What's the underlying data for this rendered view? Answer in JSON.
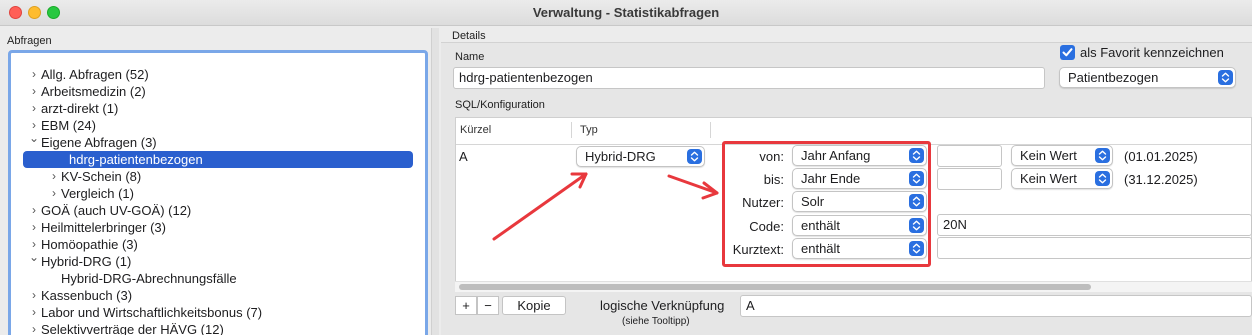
{
  "window": {
    "title": "Verwaltung - Statistikabfragen"
  },
  "left": {
    "header": "Abfragen",
    "tree": [
      {
        "label": "Allg. Abfragen (52)",
        "chevron": "right",
        "level": 0
      },
      {
        "label": "Arbeitsmedizin (2)",
        "chevron": "right",
        "level": 0
      },
      {
        "label": "arzt-direkt (1)",
        "chevron": "right",
        "level": 0
      },
      {
        "label": "EBM (24)",
        "chevron": "right",
        "level": 0
      },
      {
        "label": "Eigene Abfragen (3)",
        "chevron": "down",
        "level": 0
      },
      {
        "label": "hdrg-patientenbezogen",
        "chevron": "none",
        "level": 1,
        "selected": true
      },
      {
        "label": "KV-Schein (8)",
        "chevron": "right",
        "level": 1
      },
      {
        "label": "Vergleich (1)",
        "chevron": "right",
        "level": 1
      },
      {
        "label": "GOÄ (auch UV-GOÄ) (12)",
        "chevron": "right",
        "level": 0
      },
      {
        "label": "Heilmittelerbringer (3)",
        "chevron": "right",
        "level": 0
      },
      {
        "label": "Homöopathie (3)",
        "chevron": "right",
        "level": 0
      },
      {
        "label": "Hybrid-DRG (1)",
        "chevron": "down",
        "level": 0
      },
      {
        "label": "Hybrid-DRG-Abrechnungsfälle",
        "chevron": "none",
        "level": 1
      },
      {
        "label": "Kassenbuch (3)",
        "chevron": "right",
        "level": 0
      },
      {
        "label": "Labor und Wirtschaftlichkeitsbonus (7)",
        "chevron": "right",
        "level": 0
      },
      {
        "label": "Selektivverträge der HÄVG (12)",
        "chevron": "right",
        "level": 0
      }
    ]
  },
  "details": {
    "header": "Details",
    "name_label": "Name",
    "name_value": "hdrg-patientenbezogen",
    "favorite_label": "als Favorit kennzeichnen",
    "favorite_checked": true,
    "scope_value": "Patientbezogen",
    "sql_label": "SQL/Konfiguration",
    "table": {
      "col_kuerzel": "Kürzel",
      "col_typ": "Typ",
      "row_kuerzel": "A",
      "row_typ": "Hybrid-DRG",
      "params": {
        "von": {
          "label": "von:",
          "select": "Jahr Anfang",
          "extra_select": "Kein Wert",
          "date": "(01.01.2025)"
        },
        "bis": {
          "label": "bis:",
          "select": "Jahr Ende",
          "extra_select": "Kein Wert",
          "date": "(31.12.2025)"
        },
        "nutzer": {
          "label": "Nutzer:",
          "select": "Solr"
        },
        "code": {
          "label": "Code:",
          "select": "enthält",
          "value": "20N"
        },
        "kurztext": {
          "label": "Kurztext:",
          "select": "enthält",
          "value": ""
        }
      }
    },
    "footer": {
      "add": "+",
      "remove": "−",
      "copy": "Kopie",
      "logic_label": "logische Verknüpfung",
      "logic_hint": "(siehe Tooltipp)",
      "logic_value": "A"
    }
  },
  "colors": {
    "accent": "#2a6fe0",
    "selection": "#2a5fce",
    "annotation": "#e8383d"
  }
}
